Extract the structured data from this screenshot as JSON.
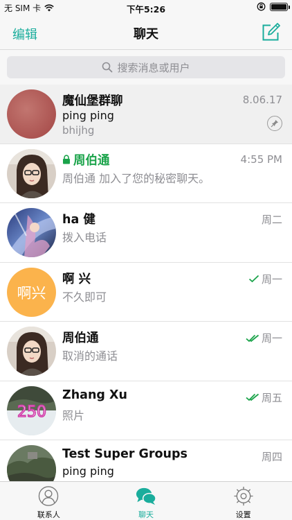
{
  "status_bar": {
    "carrier": "无 SIM 卡",
    "time": "下午5:26",
    "battery_level": 1.0
  },
  "nav": {
    "edit_label": "编辑",
    "title": "聊天"
  },
  "search": {
    "placeholder": "搜索消息或用户"
  },
  "chats": [
    {
      "name": "魔仙堡群聊",
      "line1": "ping ping",
      "line2": "bhijhg",
      "time": "8.06.17",
      "pinned": true,
      "avatar": "avatar-group-red"
    },
    {
      "name": "周伯通",
      "message": "周伯通 加入了您的秘密聊天。",
      "time": "4:55 PM",
      "secret": true,
      "avatar": "avatar-girl-photo"
    },
    {
      "name": "ha 健",
      "message": "拨入电话",
      "time": "周二",
      "avatar": "avatar-game-art"
    },
    {
      "name": "啊 兴",
      "message": "不久即可",
      "time": "周一",
      "status": "sent",
      "avatar_text": "啊兴"
    },
    {
      "name": "周伯通",
      "message": "取消的通话",
      "time": "周一",
      "status": "read",
      "avatar": "avatar-girl-photo"
    },
    {
      "name": "Zhang Xu",
      "message": "照片",
      "time": "周五",
      "status": "read",
      "avatar": "avatar-250-photo",
      "avatar_text": "250"
    },
    {
      "name": "Test Super Groups",
      "line1": "ping ping",
      "time": "周四",
      "avatar": "avatar-landscape-photo"
    }
  ],
  "tabs": [
    {
      "label": "联系人",
      "icon": "contacts-icon",
      "active": false
    },
    {
      "label": "聊天",
      "icon": "chats-icon",
      "active": true
    },
    {
      "label": "设置",
      "icon": "settings-icon",
      "active": false
    }
  ],
  "colors": {
    "accent": "#1aad9c",
    "secret": "#1aa34a",
    "subtle_text": "#8e8e93",
    "avatar_orange": "#fbb34c"
  }
}
